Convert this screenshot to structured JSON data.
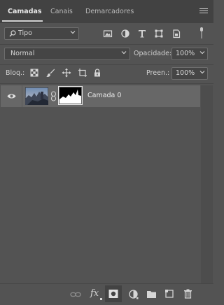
{
  "tabs": [
    {
      "label": "Camadas",
      "active": true
    },
    {
      "label": "Canais",
      "active": false
    },
    {
      "label": "Demarcadores",
      "active": false
    }
  ],
  "filter": {
    "kind_label": "Tipo",
    "icons": [
      "image-filter-icon",
      "adjustment-filter-icon",
      "type-filter-icon",
      "shape-filter-icon",
      "smart-object-filter-icon"
    ]
  },
  "blend": {
    "mode": "Normal",
    "opacity_label": "Opacidade:",
    "opacity_value": "100%"
  },
  "lock": {
    "label": "Bloq.:",
    "icons": [
      "lock-transparency-icon",
      "lock-paint-icon",
      "lock-move-icon",
      "lock-artboard-icon",
      "lock-all-icon"
    ],
    "fill_label": "Preen.:",
    "fill_value": "100%"
  },
  "layers": [
    {
      "name": "Camada 0",
      "visible": true,
      "has_mask": true,
      "selected": true
    }
  ],
  "bottom_icons": [
    "link-layers-icon",
    "fx-icon",
    "add-mask-icon",
    "adjustment-layer-icon",
    "new-group-icon",
    "new-layer-icon",
    "delete-icon"
  ],
  "bottom_labels": {
    "fx": "fx"
  }
}
